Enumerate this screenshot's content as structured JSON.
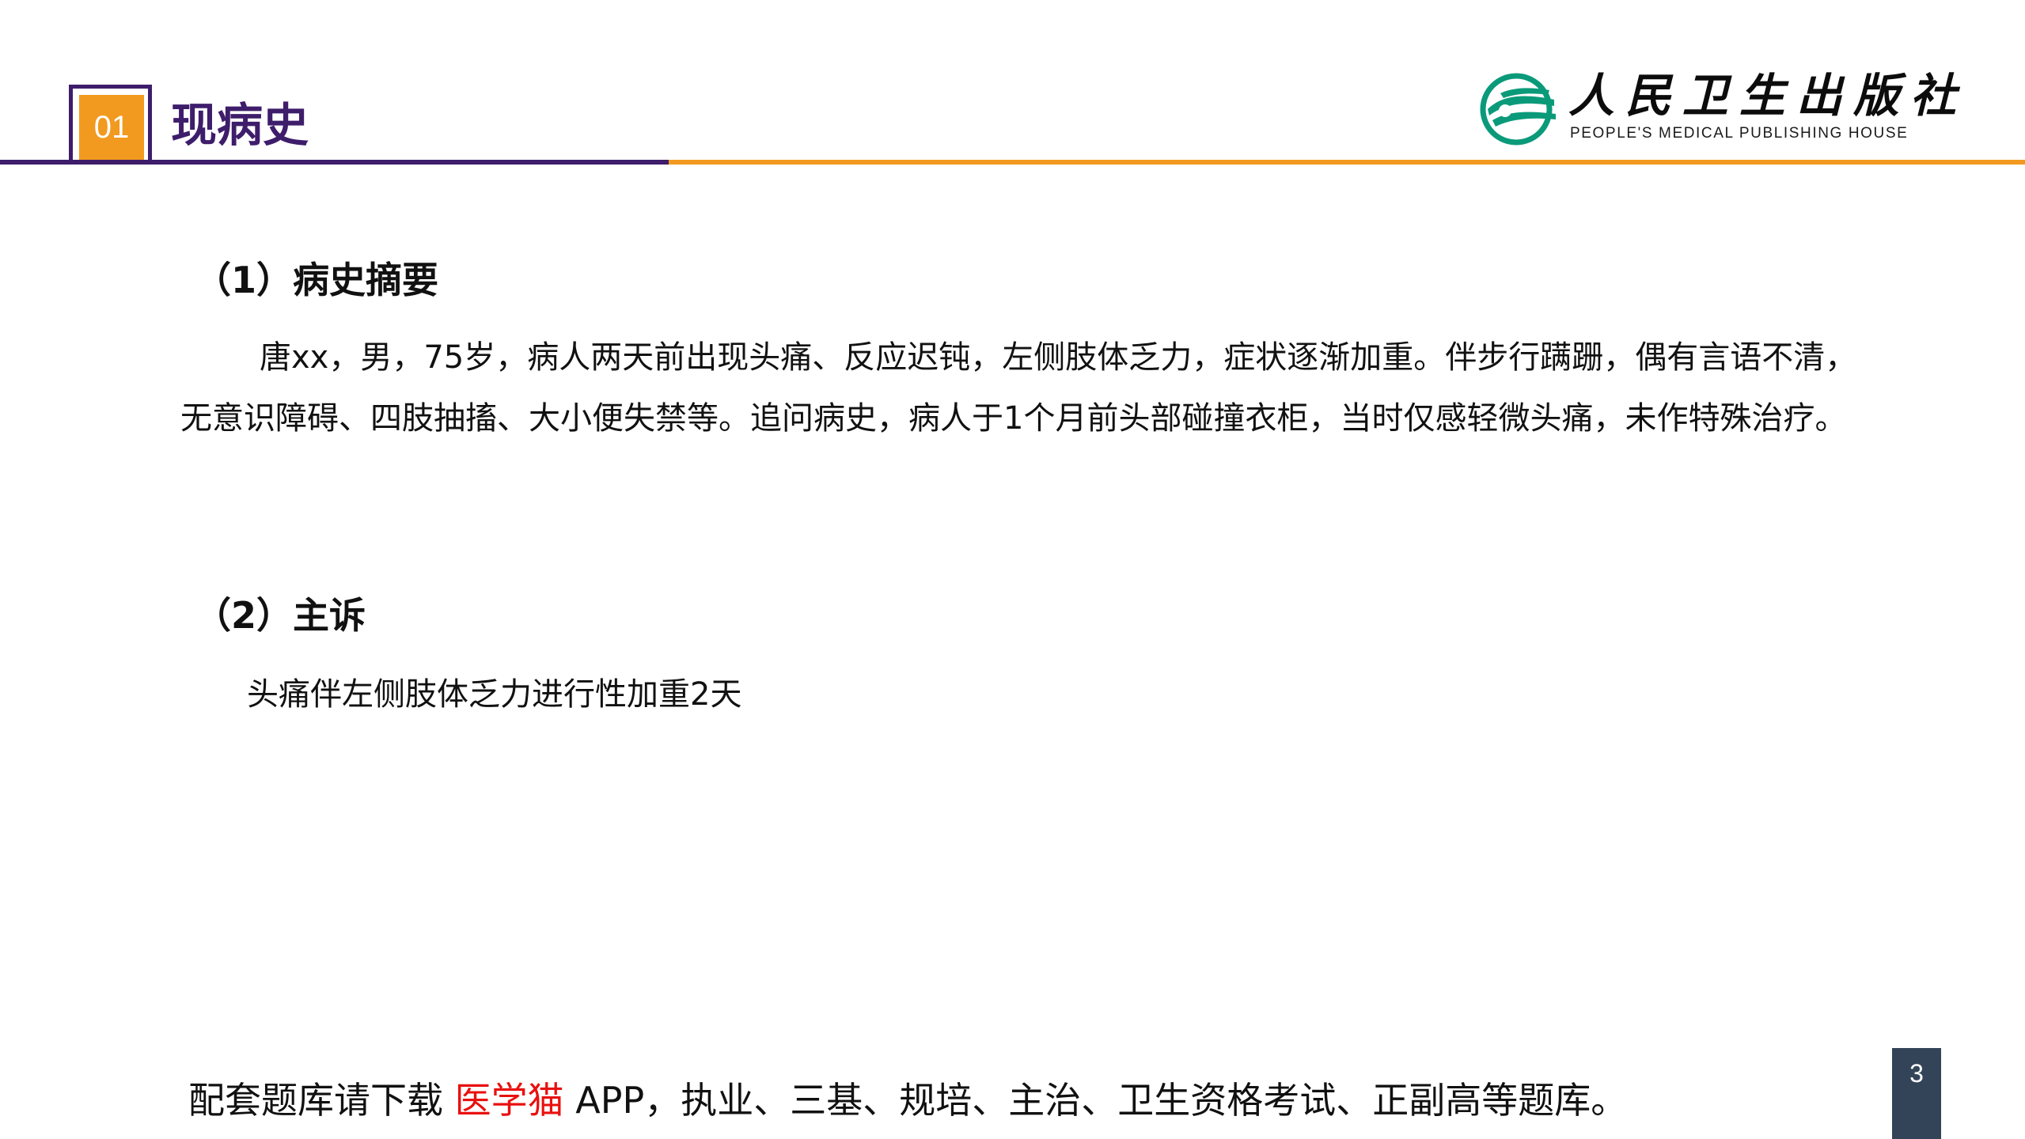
{
  "header": {
    "section_number": "01",
    "title": "现病史",
    "colors": {
      "purple": "#3e1d6b",
      "orange": "#f29a1f"
    }
  },
  "logo": {
    "emblem_icon": "peoples-medical-emblem",
    "name_cn": "人民卫生出版社",
    "name_en": "PEOPLE'S MEDICAL PUBLISHING HOUSE"
  },
  "sections": [
    {
      "heading": "（1）病史摘要",
      "text": "唐xx，男，75岁，病人两天前出现头痛、反应迟钝，左侧肢体乏力，症状逐渐加重。伴步行蹒跚，偶有言语不清，无意识障碍、四肢抽搐、大小便失禁等。追问病史，病人于1个月前头部碰撞衣柜，当时仅感轻微头痛，未作特殊治疗。"
    },
    {
      "heading": "（2）主诉",
      "text": "头痛伴左侧肢体乏力进行性加重2天"
    }
  ],
  "footer": {
    "prefix": "配套题库请下载 ",
    "app_name": "医学猫",
    "suffix": " APP，执业、三基、规培、主治、卫生资格考试、正副高等题库。",
    "accent_color": "#e8110f"
  },
  "page_number": "3"
}
